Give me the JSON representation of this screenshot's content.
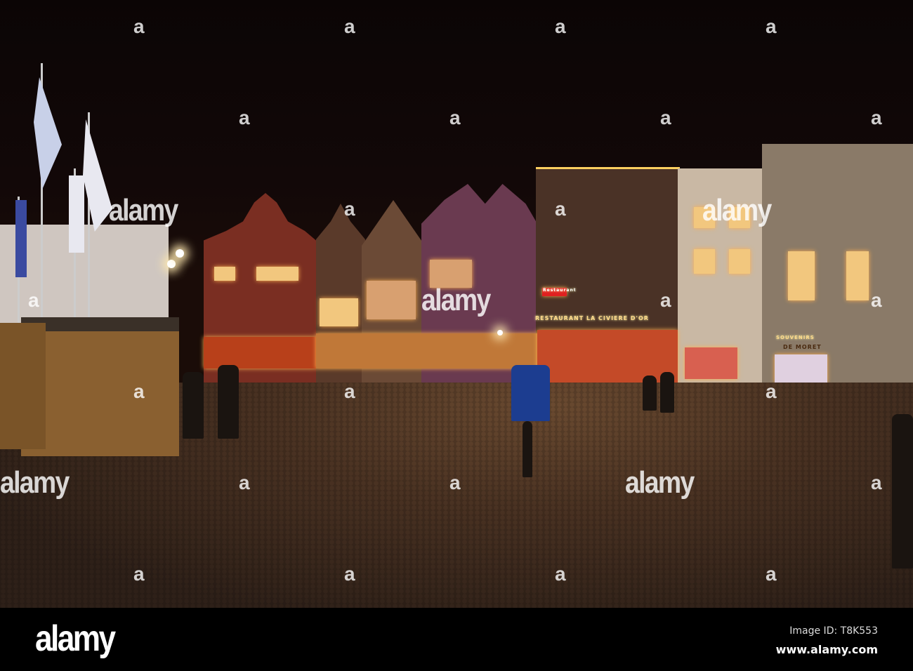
{
  "photo": {
    "signs": {
      "restaurant": "RESTAURANT LA CIVIERE D'OR",
      "restaurant_neon": "Restaurant",
      "souvenirs": "SOUVENIRS",
      "shop": "DE MORET"
    },
    "watermark": {
      "word": "alamy",
      "letter": "a"
    }
  },
  "footer": {
    "logo": "alamy",
    "image_id": "Image ID: T8K553",
    "url": "www.alamy.com"
  },
  "colors": {
    "sky": "#0b0505",
    "ground": "#4a3222",
    "lights": "#f2c77e"
  }
}
